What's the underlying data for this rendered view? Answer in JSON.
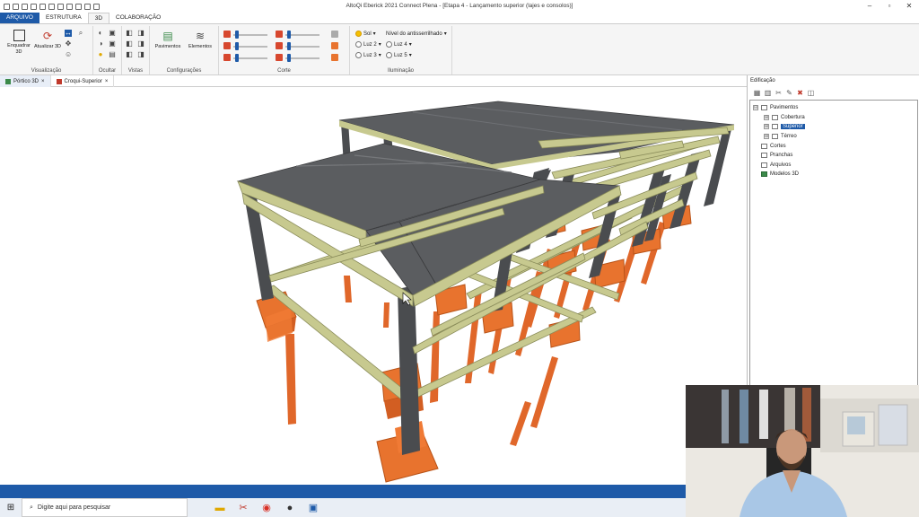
{
  "window": {
    "title": "AltoQi Eberick 2021 Connect Plena - [Etapa 4 - Lançamento superior (lajes e consolos)]",
    "controls": [
      "–",
      "▫",
      "✕"
    ]
  },
  "ribbon_tabs": [
    "ARQUIVO",
    "ESTRUTURA",
    "3D",
    "COLABORAÇÃO"
  ],
  "ribbon": {
    "visualizacao": {
      "label": "Visualização",
      "enquadrar": "Enquadrar 3D",
      "atualizar": "Atualizar 3D"
    },
    "ocultar": {
      "label": "Ocultar"
    },
    "vistas": {
      "label": "Vistas"
    },
    "configuracoes": {
      "label": "Configurações",
      "pavimentos": "Pavimentos",
      "elementos": "Elementos"
    },
    "corte": {
      "label": "Corte"
    },
    "iluminacao": {
      "label": "Iluminação",
      "sol": "Sol",
      "nivel": "Nível do antisserrilhado",
      "luz2": "Luz 2",
      "luz3": "Luz 3",
      "luz4": "Luz 4",
      "luz5": "Luz 5"
    }
  },
  "doc_tabs": [
    {
      "label": "Pórtico 3D",
      "active": true
    },
    {
      "label": "Croqui-Superior",
      "active": false
    }
  ],
  "panel": {
    "title": "Edificação",
    "tree": [
      {
        "label": "Pavimentos",
        "level": 0,
        "expand": "⊟"
      },
      {
        "label": "Cobertura",
        "level": 1,
        "expand": "⊞"
      },
      {
        "label": "Superior",
        "level": 1,
        "expand": "⊞",
        "selected": true
      },
      {
        "label": "Térreo",
        "level": 1,
        "expand": "⊞"
      },
      {
        "label": "Cortes",
        "level": 0
      },
      {
        "label": "Pranchas",
        "level": 0
      },
      {
        "label": "Arquivos",
        "level": 0
      },
      {
        "label": "Modelos 3D",
        "level": 0
      }
    ]
  },
  "taskbar": {
    "search_placeholder": "Digite aqui para pesquisar"
  },
  "colors": {
    "accent": "#1e5aa8",
    "slab": "#5b5d60",
    "beam": "#c7c98f",
    "column": "#4a4c4f",
    "footing": "#e8732e"
  }
}
